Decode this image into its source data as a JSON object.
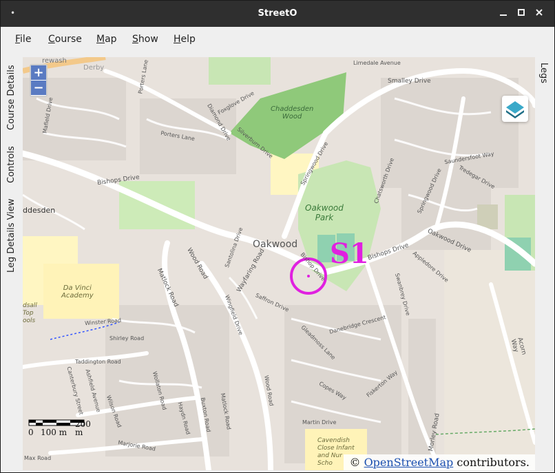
{
  "window": {
    "title": "StreetO"
  },
  "menu": [
    {
      "label": "File",
      "mnemonic": "F",
      "rest": "ile"
    },
    {
      "label": "Course",
      "mnemonic": "C",
      "rest": "ourse"
    },
    {
      "label": "Map",
      "mnemonic": "M",
      "rest": "ap"
    },
    {
      "label": "Show",
      "mnemonic": "S",
      "rest": "how"
    },
    {
      "label": "Help",
      "mnemonic": "H",
      "rest": "elp"
    }
  ],
  "left_tabs": [
    "Course Details",
    "Controls",
    "Leg Details View"
  ],
  "right_tabs": [
    "Legs"
  ],
  "map": {
    "zoom_in": "+",
    "zoom_out": "−",
    "start_label": "S1",
    "scale": {
      "zero": "0",
      "mid": "100 m",
      "end": "200",
      "unit": "m"
    },
    "attribution": {
      "prefix": "© ",
      "link": "OpenStreetMap",
      "suffix": " contributors."
    },
    "places": {
      "oakwood": "Oakwood",
      "oakwood_park": "Oakwood\nPark",
      "chaddesden_wood": "Chaddesden\nWood",
      "chaddesden": "ddesden",
      "davinci": "Da Vinci\nAcademy",
      "cavendish": "Cavendish\nClose Infant\nand Nur\nScho",
      "top_schools": "dsall\nTop\nools"
    },
    "streets": {
      "bishops_drive_w": "Bishops Drive",
      "bishops_drive_e": "Bishops Drive",
      "bishop_drive": "Bishop Drive",
      "springwood_drive": "Springwood Drive",
      "springwood_drive2": "Springwood Drive",
      "smalley_drive": "Smalley Drive",
      "oakwood_drive": "Oakwood Drive",
      "wood_road": "Wood Road",
      "wood_road_s": "Wood Road",
      "matlock_road": "Matlock Road",
      "matlock_road_s": "Matlock Road",
      "wayfaring_road": "Wayfaring Road",
      "winster_road": "Winster Road",
      "shirley_road": "Shirley Road",
      "taddington_road": "Taddington Road",
      "marjorie_road": "Marjorie Road",
      "max_road": "Max Road",
      "wilson_road": "Wilson Road",
      "wollaton_road": "Wollaton Road",
      "hayden_road": "Haydn Road",
      "buxton_road": "Buxton Road",
      "saffron_drive": "Saffron Drive",
      "danebridge_crescent": "Danebridge Crescent",
      "copes_way": "Copes Way",
      "martin_drive": "Martin Drive",
      "acorn_way": "Acorn Way",
      "saundersfoot_way": "Saundersfoot Way",
      "chatsworth_drive": "Chatsworth Drive",
      "swanbrey_drive": "Swanbrey Drive",
      "fiskerton_way": "Fiskerton Way",
      "porters_lane": "Porters Lane",
      "porters_lane2": "Porters Lane",
      "foxglove_drive": "Foxglove Drive",
      "silverburn_drive": "Silverburn Drive",
      "diamond_drive": "Diamond Drive",
      "mafield_drive": "Mafield Drive",
      "limedale_avenue": "Limedale Avenue",
      "appledore_drive": "Appledore Drive",
      "tredegar_drive": "Tredegar Drive",
      "canterbury_street": "Canterbury Street",
      "ashfield_avenue": "Ashfield Avenue",
      "cleadmoss_lane": "Gleadmoss Lane",
      "wingfield_drive": "Wingfield Drive",
      "santolina_drive": "Santolina Drive",
      "tarley_road": "Morley Road",
      "derby": "Derby",
      "brewash": "rewash"
    }
  },
  "colors": {
    "titlebar": "#2f2f2f",
    "control": "#e020e0",
    "park": "#c8e6b4",
    "wood": "#8fc97a",
    "road": "#ffffff"
  }
}
